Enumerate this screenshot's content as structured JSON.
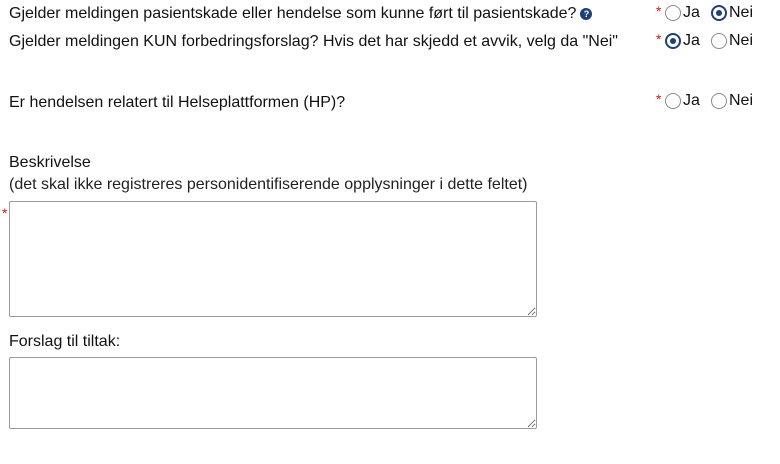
{
  "questions": [
    {
      "label": "Gjelder meldingen pasientskade eller hendelse som kunne ført til pasientskade?",
      "required_mark": "*",
      "has_help": true,
      "help_icon": "question-circle-icon",
      "options": [
        "Ja",
        "Nei"
      ],
      "selected": "Nei"
    },
    {
      "label": "Gjelder meldingen KUN forbedringsforslag? Hvis det har skjedd et avvik, velg da \"Nei\"",
      "required_mark": "*",
      "has_help": false,
      "options": [
        "Ja",
        "Nei"
      ],
      "selected": "Ja"
    },
    {
      "label": "Er hendelsen relatert til Helseplattformen (HP)?",
      "required_mark": "*",
      "has_help": false,
      "options": [
        "Ja",
        "Nei"
      ],
      "selected": null
    }
  ],
  "beskrivelse": {
    "label": "Beskrivelse",
    "hint": "(det skal ikke registreres personidentifiserende opplysninger i dette feltet)",
    "required_mark": "*",
    "value": ""
  },
  "tiltak": {
    "label": "Forslag til tiltak:",
    "value": ""
  },
  "colors": {
    "accent": "#1d3f76",
    "required": "#dd1111"
  }
}
